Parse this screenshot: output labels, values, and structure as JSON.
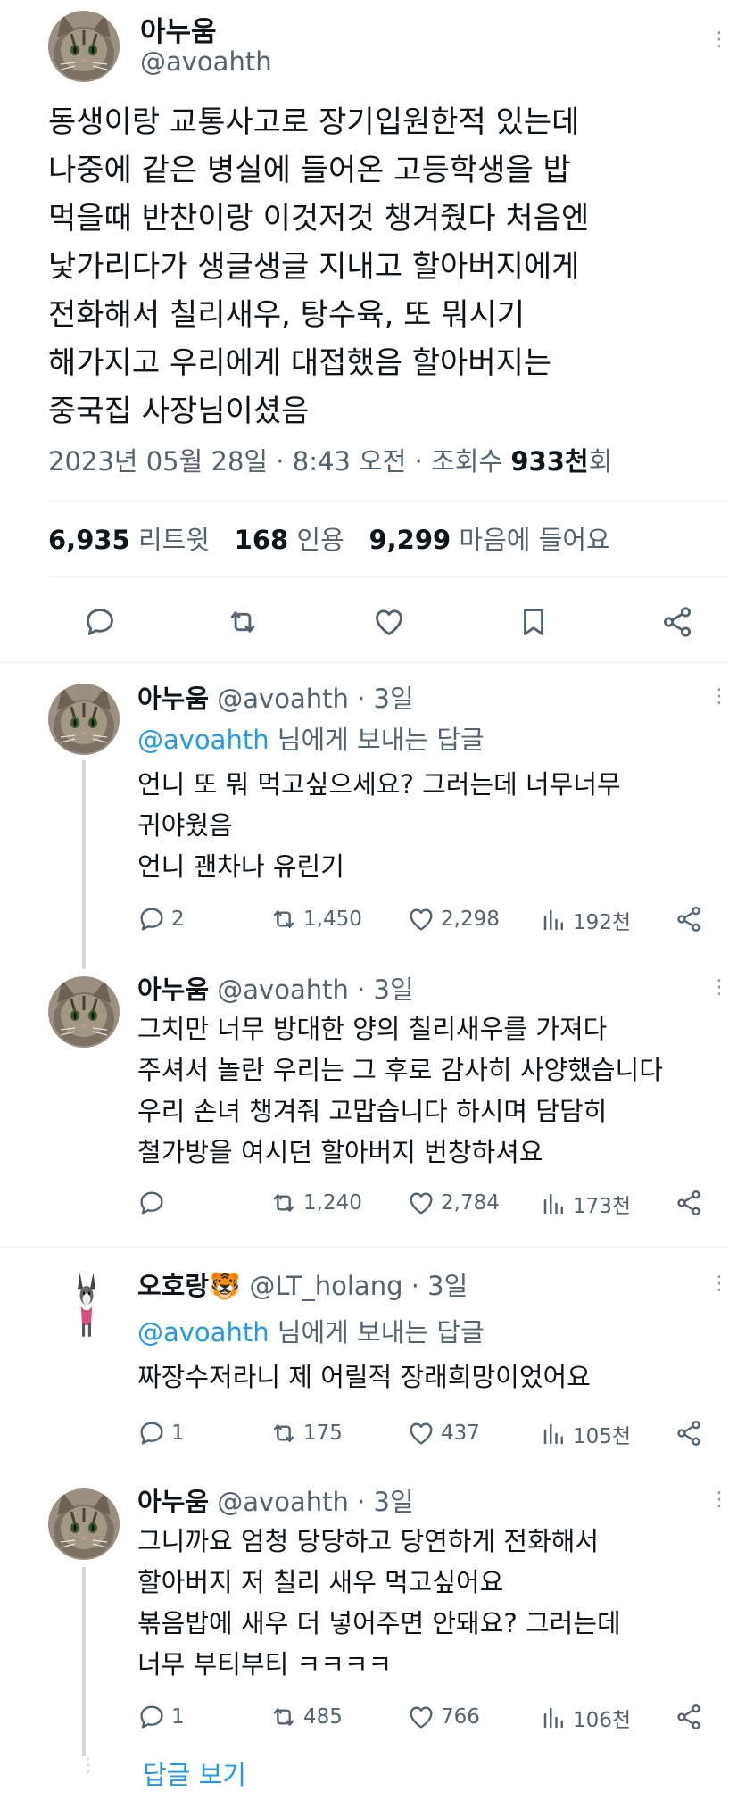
{
  "main_tweet": {
    "display_name": "아누움",
    "handle": "@avoahth",
    "body_lines": [
      "동생이랑 교통사고로 장기입원한적 있는데",
      "나중에 같은 병실에 들어온 고등학생을 밥",
      "먹을때 반찬이랑 이것저것 챙겨줬다 처음엔",
      "낯가리다가 생글생글 지내고 할아버지에게",
      "전화해서 칠리새우, 탕수육, 또 뭐시기",
      "해가지고 우리에게 대접했음 할아버지는",
      "중국집 사장님이셨음"
    ],
    "time": "2023년 05월 28일 · 8:43 오전 · 조회수",
    "views": "933천",
    "views_suffix": "회",
    "retweets_count": "6,935",
    "retweets_label": "리트윗",
    "quotes_count": "168",
    "quotes_label": "인용",
    "likes_count": "9,299",
    "likes_label": "마음에 들어요"
  },
  "replies": [
    {
      "display_name": "아누움",
      "handle": "@avoahth",
      "time": "· 3일",
      "replying_to": "@avoahth",
      "replying_suffix": "님에게 보내는 답글",
      "lines": [
        "언니 또 뭐 먹고싶으세요? 그러는데 너무너무",
        "귀야웠음",
        "언니 괜차나 유린기"
      ],
      "replies_count": "2",
      "retweets_count": "1,450",
      "likes_count": "2,298",
      "views_count": "192천"
    },
    {
      "display_name": "아누움",
      "handle": "@avoahth",
      "time": "· 3일",
      "lines": [
        "그치만 너무 방대한 양의 칠리새우를 가져다",
        "주셔서 놀란 우리는 그 후로 감사히 사양했습니다",
        "우리 손녀 챙겨줘 고맙습니다 하시며 담담히",
        "철가방을 여시던 할아버지 번창하셔요"
      ],
      "replies_count": "",
      "retweets_count": "1,240",
      "likes_count": "2,784",
      "views_count": "173천"
    },
    {
      "display_name": "오호랑",
      "name_emoji": "🐯",
      "handle": "@LT_holang",
      "time": "· 3일",
      "replying_to": "@avoahth",
      "replying_suffix": "님에게 보내는 답글",
      "lines": [
        "짜장수저라니 제 어릴적 장래희망이었어요"
      ],
      "replies_count": "1",
      "retweets_count": "175",
      "likes_count": "437",
      "views_count": "105천"
    },
    {
      "display_name": "아누움",
      "handle": "@avoahth",
      "time": "· 3일",
      "lines": [
        "그니까요 엄청 당당하고 당연하게 전화해서",
        "할아버지 저 칠리 새우 먹고싶어요",
        "볶음밥에 새우 더 넣어주면 안돼요? 그러는데",
        "너무 부티부티 ㅋㅋㅋㅋ"
      ],
      "replies_count": "1",
      "retweets_count": "485",
      "likes_count": "766",
      "views_count": "106천"
    }
  ],
  "show_replies_label": "답글 보기",
  "icons": {
    "reply": "speech-bubble-icon",
    "retweet": "retweet-icon",
    "like": "heart-icon",
    "bookmark": "bookmark-icon",
    "share": "share-icon",
    "views": "bar-chart-icon",
    "more": "more-vertical-icon"
  },
  "colors": {
    "link": "#1d9bf0",
    "secondary": "#536471",
    "divider": "#eff3f4"
  }
}
